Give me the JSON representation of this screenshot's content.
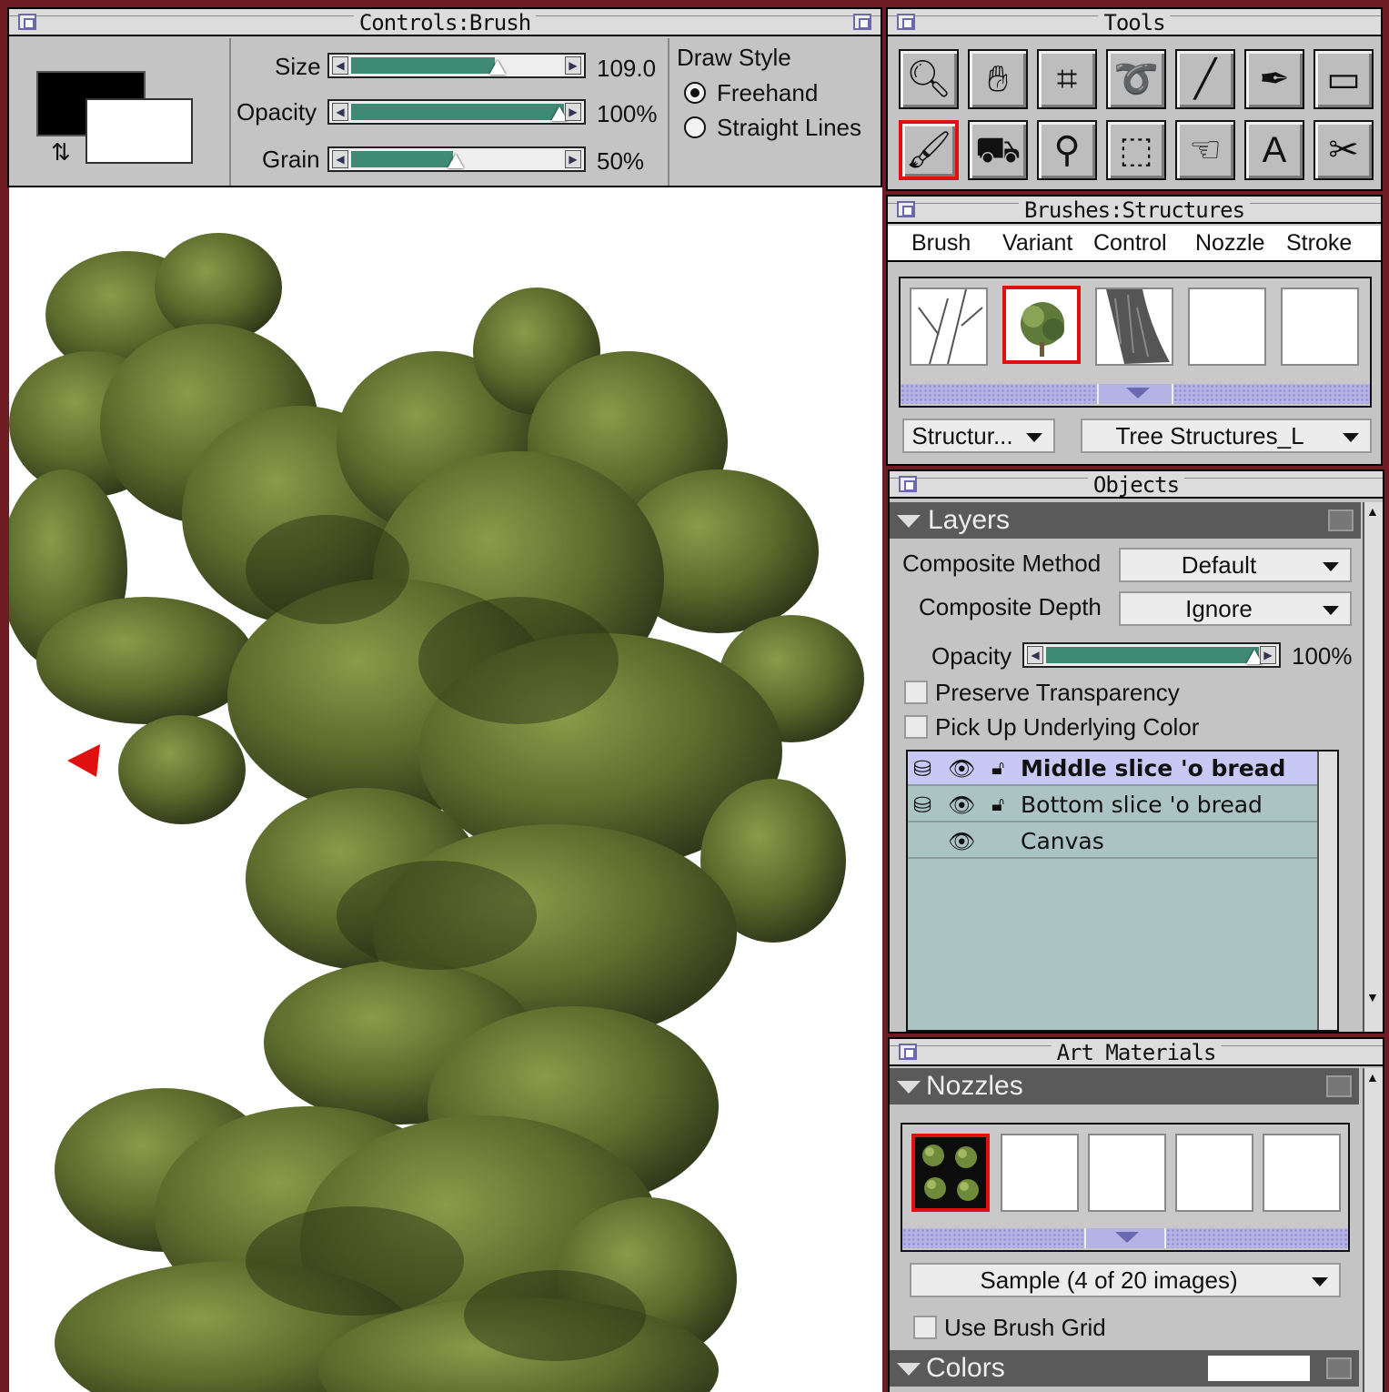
{
  "controls_panel": {
    "title": "Controls:Brush",
    "size_label": "Size",
    "size_value": "109.0",
    "size_fraction": 0.62,
    "opacity_label": "Opacity",
    "opacity_value": "100%",
    "opacity_fraction": 1.0,
    "grain_label": "Grain",
    "grain_value": "50%",
    "grain_fraction": 0.5,
    "draw_style_label": "Draw Style",
    "freehand_label": "Freehand",
    "straight_lines_label": "Straight Lines",
    "selected_draw_style": "Freehand",
    "primary_color": "#000000",
    "secondary_color": "#ffffff"
  },
  "tools_panel": {
    "title": "Tools",
    "tools": [
      {
        "name": "magnifier",
        "glyph": "🔍︎"
      },
      {
        "name": "grabber",
        "glyph": "✋︎"
      },
      {
        "name": "crop",
        "glyph": "⌗"
      },
      {
        "name": "lasso",
        "glyph": "➰"
      },
      {
        "name": "line",
        "glyph": "╱"
      },
      {
        "name": "pen",
        "glyph": "✒︎"
      },
      {
        "name": "rectangle",
        "glyph": "▭"
      },
      {
        "name": "brush",
        "glyph": "🖌︎"
      },
      {
        "name": "paint-bucket",
        "glyph": "⛟"
      },
      {
        "name": "dropper",
        "glyph": "⚲"
      },
      {
        "name": "rect-select",
        "glyph": "⬚"
      },
      {
        "name": "layer-adjuster",
        "glyph": "☜"
      },
      {
        "name": "text",
        "glyph": "A"
      },
      {
        "name": "scissors",
        "glyph": "✂︎"
      }
    ],
    "selected_tool": "brush"
  },
  "brushes_panel": {
    "title": "Brushes:Structures",
    "menu": [
      "Brush",
      "Variant",
      "Control",
      "Nozzle",
      "Stroke"
    ],
    "category_select": "Structur...",
    "variant_select": "Tree Structures_L"
  },
  "objects_panel": {
    "title": "Objects",
    "section": "Layers",
    "composite_method_label": "Composite Method",
    "composite_method_value": "Default",
    "composite_depth_label": "Composite Depth",
    "composite_depth_value": "Ignore",
    "opacity_label": "Opacity",
    "opacity_value": "100%",
    "opacity_fraction": 1.0,
    "preserve_transparency_label": "Preserve Transparency",
    "pick_up_label": "Pick Up Underlying Color",
    "layers": [
      {
        "name": "Middle slice 'o bread",
        "selected": true
      },
      {
        "name": "Bottom slice 'o bread",
        "selected": false
      },
      {
        "name": "Canvas",
        "selected": false
      }
    ]
  },
  "art_materials_panel": {
    "title": "Art Materials",
    "nozzles_section": "Nozzles",
    "nozzle_select": "Sample (4 of 20  images)",
    "use_brush_grid_label": "Use Brush Grid",
    "colors_section": "Colors"
  },
  "colors": {
    "accent_red": "#e01010",
    "slider_green": "#3f8a74",
    "layer_list_bg": "#abc3c3",
    "selected_layer_bg": "#c8c8f4",
    "frame": "#6e1c22"
  }
}
